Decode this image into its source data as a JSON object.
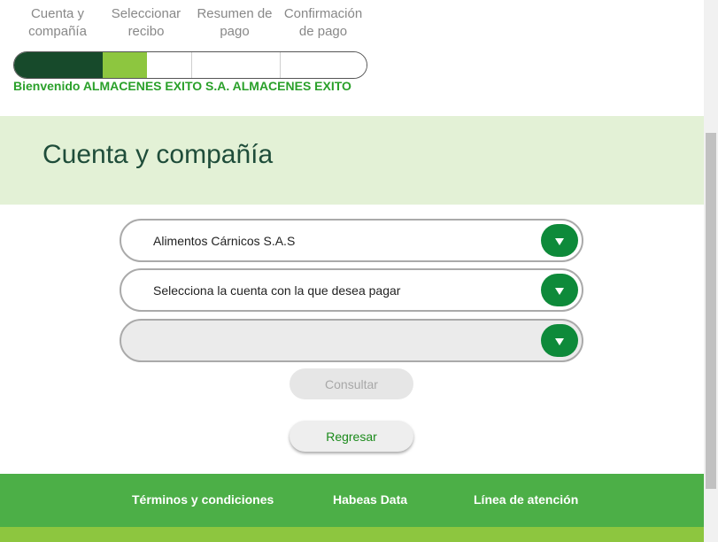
{
  "steps": [
    {
      "label": "Cuenta y\ncompañía"
    },
    {
      "label": "Seleccionar\nrecibo"
    },
    {
      "label": "Resumen de\npago"
    },
    {
      "label": "Confirmación\nde pago"
    }
  ],
  "progress": {
    "completed_steps": 1.5,
    "total_steps": 4
  },
  "welcome_text": "Bienvenido ALMACENES EXITO S.A. ALMACENES EXITO",
  "banner": {
    "title": "Cuenta y compañía"
  },
  "form": {
    "company_value": "Alimentos Cárnicos S.A.S",
    "account_placeholder": "Selecciona la cuenta con la que desea pagar",
    "third_value": ""
  },
  "buttons": {
    "consult": "Consultar",
    "back": "Regresar"
  },
  "footer": {
    "terms": "Términos y condiciones",
    "habeas": "Habeas Data",
    "support": "Línea de atención"
  },
  "colors": {
    "primary_green": "#0e8a3a",
    "dark_green": "#174a2b",
    "light_green": "#8dc63f",
    "footer_green": "#4caf47",
    "banner_bg": "#e3f1d6"
  }
}
